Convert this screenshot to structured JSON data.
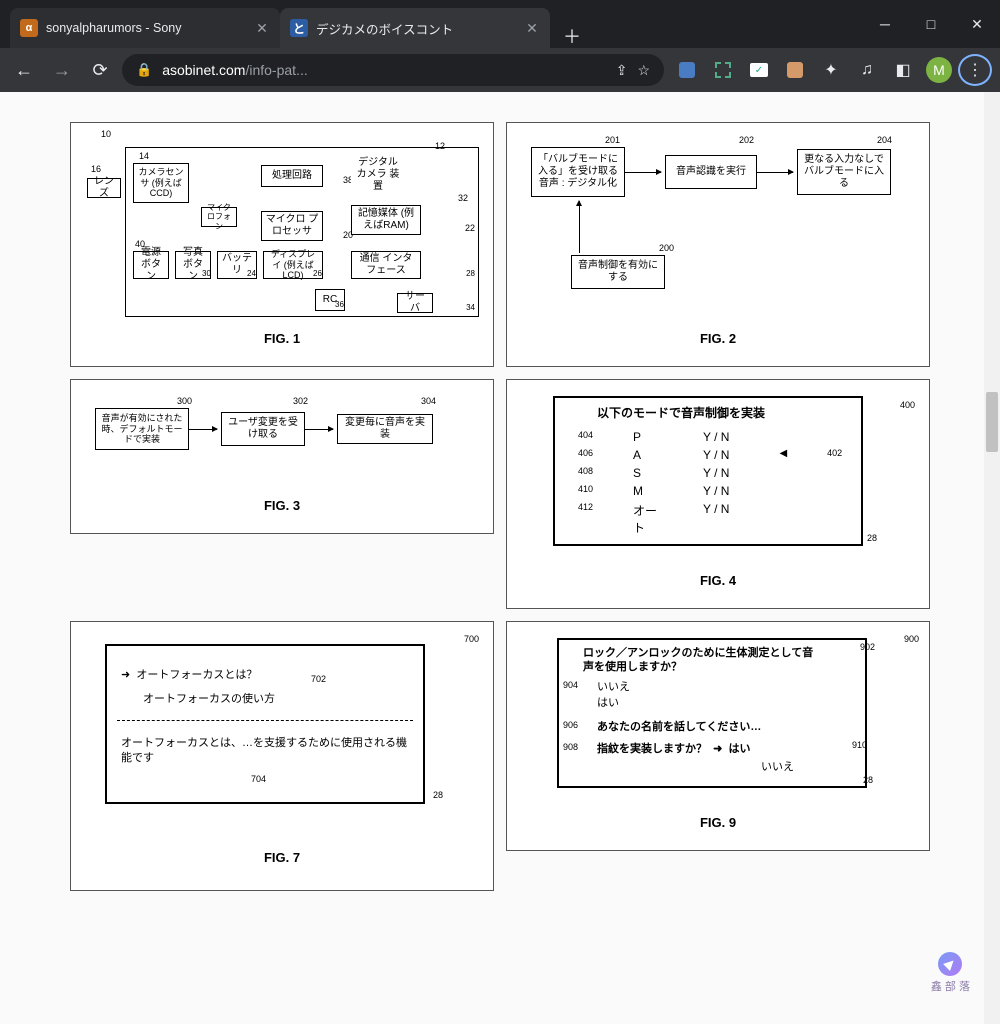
{
  "tabs": [
    {
      "favicon": "α",
      "title": "sonyalpharumors - Sony"
    },
    {
      "favicon": "と",
      "title": "デジカメのボイスコント"
    }
  ],
  "url": {
    "domain": "asobinet.com",
    "path": "/info-pat..."
  },
  "avatar": "M",
  "fig1": {
    "cap": "FIG. 1",
    "n10": "10",
    "n12": "12",
    "n14": "14",
    "n16": "16",
    "lens": "レンズ",
    "sensor": "カメラセンサ (例えばCCD)",
    "mic": "マイクロフォン",
    "proc": "処理回路",
    "device": "デジタル\nカメラ\n装置",
    "mpu": "マイクロ\nプロセッサ",
    "mem": "記憶媒体\n(例えばRAM)",
    "pwr": "電源\nボタン",
    "photo": "写真\nボタン",
    "batt": "バッテリ",
    "disp": "ディスプレイ\n(例えばLCD)",
    "comm": "通信\nインタフェース",
    "rc": "RC",
    "server": "サーバ",
    "r38": "38",
    "r32": "32",
    "r20": "20",
    "r22": "22",
    "r30": "30",
    "r24": "24",
    "r26": "26",
    "r28": "28",
    "r36": "36",
    "r34": "34",
    "r40": "40"
  },
  "fig2": {
    "cap": "FIG. 2",
    "n201": "201",
    "n202": "202",
    "n204": "204",
    "n200": "200",
    "b1": "「バルブモードに入る」を受け取る\n音声 : デジタル化",
    "b2": "音声認識を実行",
    "b3": "更なる入力なしでバルブモードに入る",
    "b4": "音声制御を有効にする"
  },
  "fig3": {
    "cap": "FIG. 3",
    "n300": "300",
    "n302": "302",
    "n304": "304",
    "b1": "音声が有効にされた時、デフォルトモードで実装",
    "b2": "ユーザ変更を受け取る",
    "b3": "変更毎に音声を実装"
  },
  "fig4": {
    "cap": "FIG. 4",
    "title": "以下のモードで音声制御を実装",
    "n400": "400",
    "n402": "402",
    "n28": "28",
    "rows": [
      {
        "n": "404",
        "mode": "P",
        "val": "Y / N"
      },
      {
        "n": "406",
        "mode": "A",
        "val": "Y / N"
      },
      {
        "n": "408",
        "mode": "S",
        "val": "Y / N"
      },
      {
        "n": "410",
        "mode": "M",
        "val": "Y / N"
      },
      {
        "n": "412",
        "mode": "オート",
        "val": "Y / N"
      }
    ]
  },
  "fig7": {
    "cap": "FIG. 7",
    "n700": "700",
    "n702": "702",
    "n704": "704",
    "n28": "28",
    "l1": "オートフォーカスとは？",
    "l2": "オートフォーカスの使い方",
    "l3": "オートフォーカスとは、…を支援するために使用される機能です"
  },
  "fig9": {
    "cap": "FIG. 9",
    "n900": "900",
    "n902": "902",
    "n904": "904",
    "n906": "906",
    "n908": "908",
    "n910": "910",
    "n28": "28",
    "l1": "ロック／アンロックのために生体測定として音声を使用しますか？",
    "l2a": "いいえ",
    "l2b": "はい",
    "l3": "あなたの名前を話してください…",
    "l4": "指紋を実装しますか？",
    "l4y": "はい",
    "l4n": "いいえ"
  },
  "watermark": "鑫 部 落"
}
